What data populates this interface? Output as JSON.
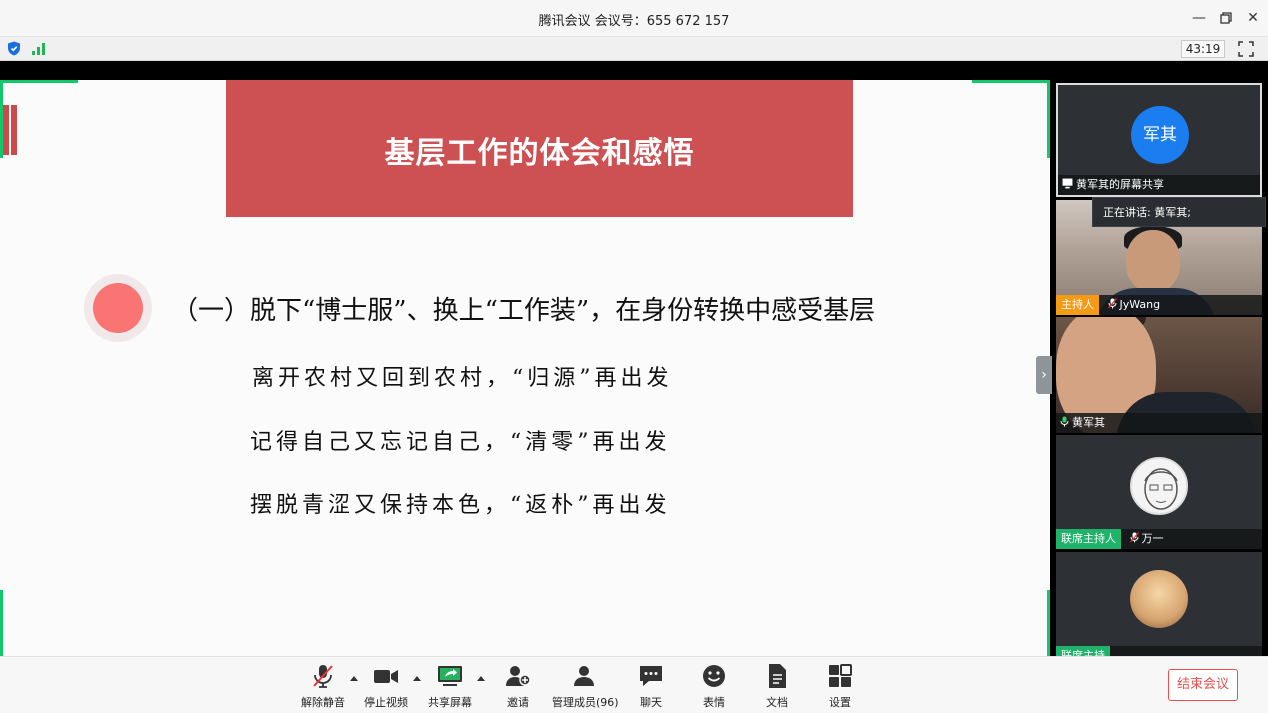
{
  "window": {
    "title": "腾讯会议 会议号：655 672 157"
  },
  "statusbar": {
    "timer": "43:19"
  },
  "slide": {
    "title": "基层工作的体会和感悟",
    "heading": "（一）脱下“博士服”、换上“工作装”，在身份转换中感受基层",
    "lines": [
      "离开农村又回到农村，“归源”再出发",
      "记得自己又忘记自己，“清零”再出发",
      "摆脱青涩又保持本色，“返朴”再出发"
    ]
  },
  "participants": {
    "speaking_label": "正在讲话: 黄军其;",
    "share": {
      "avatar_text": "军其",
      "label": "黄军其的屏幕共享"
    },
    "p1": {
      "tag": "主持人",
      "name": "JyWang"
    },
    "p2": {
      "name": "黄军其"
    },
    "p3": {
      "tag": "联席主持人",
      "name": "万一"
    },
    "p4": {
      "tag": "联席主持",
      "name": ""
    }
  },
  "toolbar": {
    "unmute": "解除静音",
    "stop_video": "停止视频",
    "share_screen": "共享屏幕",
    "invite": "邀请",
    "manage_members": "管理成员(96)",
    "chat": "聊天",
    "reaction": "表情",
    "docs": "文档",
    "settings": "设置",
    "end_meeting": "结束会议"
  },
  "colors": {
    "banner": "#cd5153",
    "accent_green": "#11c86b",
    "host_tag": "#f59a14",
    "cohost_tag": "#1fb26a",
    "end_button": "#e9504f"
  }
}
